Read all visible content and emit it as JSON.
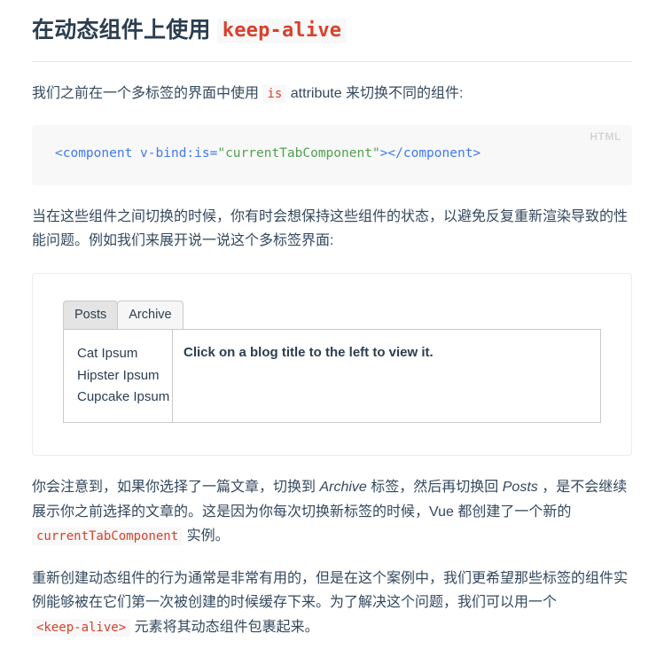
{
  "heading": {
    "text_before": "在动态组件上使用",
    "code": "keep-alive"
  },
  "intro_paragraph": {
    "part1": "我们之前在一个多标签的界面中使用",
    "code": "is",
    "part2": "attribute 来切换不同的组件:"
  },
  "code_block": {
    "language_label": "HTML",
    "tokens": {
      "tag_open": "<component",
      "attribute": " v-bind:is=",
      "string": "\"currentTabComponent\"",
      "tag_close": "></component>"
    },
    "full_text": "<component v-bind:is=\"currentTabComponent\"></component>"
  },
  "paragraph_switch": {
    "text": "当在这些组件之间切换的时候，你有时会想保持这些组件的状态，以避免反复重新渲染导致的性能问题。例如我们来展开说一说这个多标签界面:"
  },
  "demo": {
    "tabs": [
      {
        "label": "Posts",
        "active": true
      },
      {
        "label": "Archive",
        "active": false
      }
    ],
    "posts": [
      "Cat Ipsum",
      "Hipster Ipsum",
      "Cupcake Ipsum"
    ],
    "detail_text": "Click on a blog title to the left to view it."
  },
  "paragraph_notice": {
    "part1": "你会注意到，如果你选择了一篇文章，切换到",
    "em1": "Archive",
    "part2": "标签，然后再切换回",
    "em2": "Posts",
    "part3": "，是不会继续展示你之前选择的文章的。这是因为你每次切换新标签的时候，Vue 都创建了一个新的",
    "code": "currentTabComponent",
    "part4": "实例。"
  },
  "paragraph_solution": {
    "part1": "重新创建动态组件的行为通常是非常有用的，但是在这个案例中，我们更希望那些标签的组件实例能够被在它们第一次被创建的时候缓存下来。为了解决这个问题，我们可以用一个",
    "code": "<keep-alive>",
    "part2": "元素将其动态组件包裹起来。"
  },
  "colors": {
    "heading": "#2c3e50",
    "body_text": "#34495e",
    "inline_code_orange": "#e96900",
    "inline_code_red": "#d9402b",
    "code_string_green": "#50a14f",
    "code_tag_blue": "#4078f2",
    "code_bg": "#f8f8f8",
    "lang_label": "#d6d6d6",
    "border": "#c9c9c9",
    "demo_border": "#ececec"
  }
}
